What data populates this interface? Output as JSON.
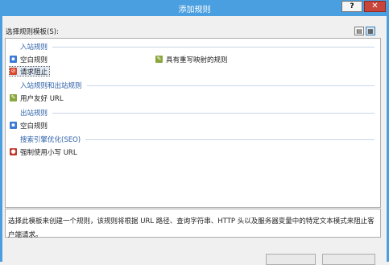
{
  "window": {
    "title": "添加规则",
    "help_label": "?",
    "close_label": "✕"
  },
  "select_label": "选择规则模板(S):",
  "view_buttons": [
    "▤",
    "▦"
  ],
  "groups": [
    {
      "label": "入站规则"
    },
    {
      "label": "入站规则和出站规则"
    },
    {
      "label": "出站规则"
    },
    {
      "label": "搜索引擎优化(SEO)"
    }
  ],
  "items": [
    {
      "label": "空白规则",
      "icon": "blank-rule-icon",
      "color": "#3b7bd4"
    },
    {
      "label": "具有重写映射的规则",
      "icon": "rewrite-map-rule-icon",
      "color": "#8aa63c"
    },
    {
      "label": "请求阻止",
      "icon": "request-block-icon",
      "color": "#d9482b"
    },
    {
      "label": "用户友好 URL",
      "icon": "user-friendly-url-icon",
      "color": "#8aa63c"
    },
    {
      "label": "空白规则",
      "icon": "blank-outbound-rule-icon",
      "color": "#3b7bd4"
    },
    {
      "label": "强制使用小写 URL",
      "icon": "lowercase-url-icon",
      "color": "#c0392b"
    }
  ],
  "description": {
    "line1": "选择此模板来创建一个规则，该规则将根据 URL 路径、查询字符串、HTTP 头以及服务器变量中的特定文本模式来阻止客",
    "line2": "户端请求。"
  }
}
